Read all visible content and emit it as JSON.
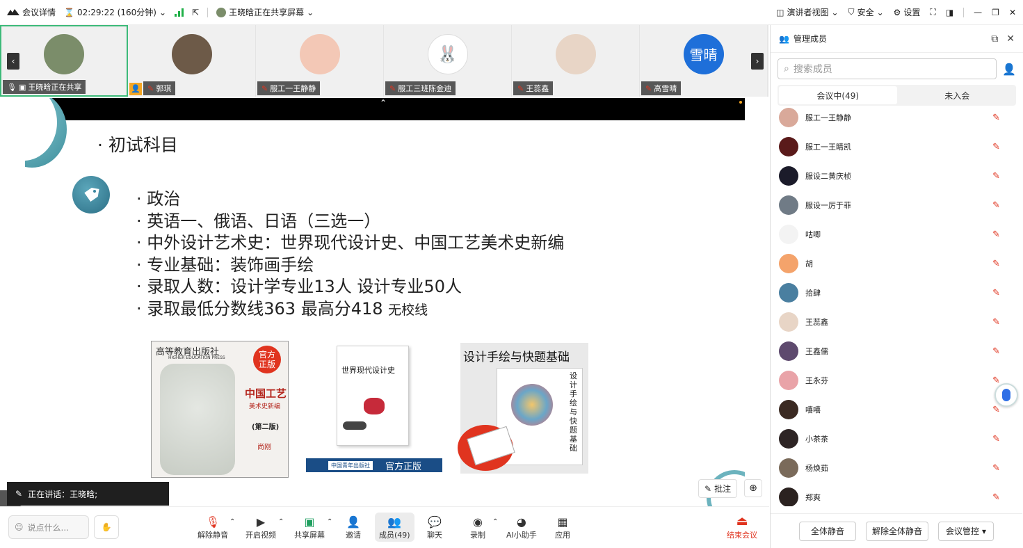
{
  "titlebar": {
    "meeting_details": "会议详情",
    "duration": "02:29:22 (160分钟)",
    "sharing_status": "王晓晗正在共享屏幕",
    "presenter_view": "演讲者视图",
    "security": "安全",
    "settings": "设置"
  },
  "thumbnails": [
    {
      "name": "王晓晗正在共享",
      "color": "#7b8d6a"
    },
    {
      "name": "郭琪",
      "color": "#6d5a48"
    },
    {
      "name": "服工一王静静",
      "color": "#f3c8b6"
    },
    {
      "name": "服工三班陈金迪",
      "color": "#ffffff"
    },
    {
      "name": "王蕊鑫",
      "color": "#e8d5c6"
    },
    {
      "name": "高雪晴",
      "color": "#1e6fd9",
      "initials": "雪晴"
    }
  ],
  "slide": {
    "heading": "· 初试科目",
    "bullets": [
      "· 政治",
      "· 英语一、俄语、日语（三选一）",
      "· 中外设计艺术史：世界现代设计史、中国工艺美术史新编",
      "· 专业基础：装饰画手绘",
      "· 录取人数：设计学专业13人 设计专业50人"
    ],
    "last_bullet_main": "· 录取最低分数线363 最高分418",
    "last_bullet_small": "无校线",
    "book1": {
      "publisher": "高等教育出版社",
      "publisher_en": "HIGHER EDUCATION PRESS",
      "badge": "官方正版",
      "title": "中国工艺",
      "subtitle": "美术史新编",
      "edition": "(第二版)",
      "author": "尚刚"
    },
    "book2": {
      "title": "世界现代设计史",
      "publisher_banner": "中国青年出版社",
      "badge": "官方正版"
    },
    "book3": {
      "title": "设计手绘与快题基础",
      "spine": "设计手绘与快题基础"
    }
  },
  "stage": {
    "annotate": "批注",
    "speaking": "正在讲话：王晓晗;"
  },
  "toolbar": {
    "chat_placeholder": "说点什么...",
    "unmute": "解除静音",
    "video": "开启视频",
    "share": "共享屏幕",
    "invite": "邀请",
    "members": "成员(49)",
    "chat": "聊天",
    "record": "录制",
    "ai": "AI小助手",
    "apps": "应用",
    "end": "结束会议"
  },
  "panel": {
    "title": "管理成员",
    "search_placeholder": "搜索成员",
    "tab_in": "会议中(49)",
    "tab_out": "未入会",
    "members": [
      {
        "name": "服工一王静静",
        "color": "#d9a99a"
      },
      {
        "name": "服工一王睛凯",
        "color": "#5a1a1a"
      },
      {
        "name": "服设二黄庆桢",
        "color": "#1b1b2a"
      },
      {
        "name": "服设一厉于菲",
        "color": "#707b86"
      },
      {
        "name": "咕唧",
        "color": "#f3f3f3"
      },
      {
        "name": "胡",
        "color": "#f4a36b"
      },
      {
        "name": "拾肆",
        "color": "#4a7fa0"
      },
      {
        "name": "王蕊鑫",
        "color": "#e8d5c6"
      },
      {
        "name": "王鑫儒",
        "color": "#5e4a6e"
      },
      {
        "name": "王永芬",
        "color": "#e9a3a8"
      },
      {
        "name": "嘻嘻",
        "color": "#3b2a22"
      },
      {
        "name": "小茶茶",
        "color": "#2d2424"
      },
      {
        "name": "杨焕茹",
        "color": "#7a6a5a"
      },
      {
        "name": "郑爽",
        "color": "#2b2220"
      }
    ],
    "mute_all": "全体静音",
    "unmute_all": "解除全体静音",
    "control": "会议管控"
  }
}
